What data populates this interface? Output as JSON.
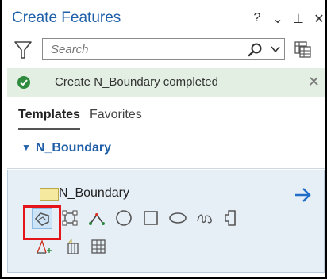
{
  "pane": {
    "title": "Create Features",
    "controls": [
      {
        "name": "help-button",
        "glyph": "?"
      },
      {
        "name": "options-dropdown-button",
        "glyph": "⌄"
      },
      {
        "name": "auto-hide-pin-button",
        "glyph": "⊥"
      },
      {
        "name": "close-pane-button",
        "glyph": "✕"
      }
    ]
  },
  "search": {
    "placeholder": "Search",
    "value": ""
  },
  "banner": {
    "text": "Create N_Boundary completed",
    "status_color": "#2e8b3e"
  },
  "tabs": {
    "items": [
      "Templates",
      "Favorites"
    ],
    "active": "Templates"
  },
  "group": {
    "label": "N_Boundary",
    "expanded": true
  },
  "template": {
    "label": "N_Boundary",
    "swatch_color": "#f5e9a0",
    "arrow_color": "#1f6fc8",
    "tools": [
      {
        "name": "polygon-tool",
        "icon": "polygon-icon",
        "selected": true
      },
      {
        "name": "rectangle-tool",
        "icon": "rectangle-tool-icon",
        "selected": false
      },
      {
        "name": "line-tool",
        "icon": "line-icon",
        "selected": false
      },
      {
        "name": "circle-tool",
        "icon": "circle-icon",
        "selected": false
      },
      {
        "name": "square-tool",
        "icon": "square-icon",
        "selected": false
      },
      {
        "name": "ellipse-tool",
        "icon": "ellipse-icon",
        "selected": false
      },
      {
        "name": "freehand-tool",
        "icon": "freehand-icon",
        "selected": false
      },
      {
        "name": "auto-complete-polygon-tool",
        "icon": "auto-complete-icon",
        "selected": false
      },
      {
        "name": "trace-tool",
        "icon": "trace-icon",
        "selected": false
      },
      {
        "name": "extrude-tool",
        "icon": "extrude-icon",
        "selected": false
      },
      {
        "name": "table-tool",
        "icon": "table-icon",
        "selected": false
      }
    ]
  }
}
